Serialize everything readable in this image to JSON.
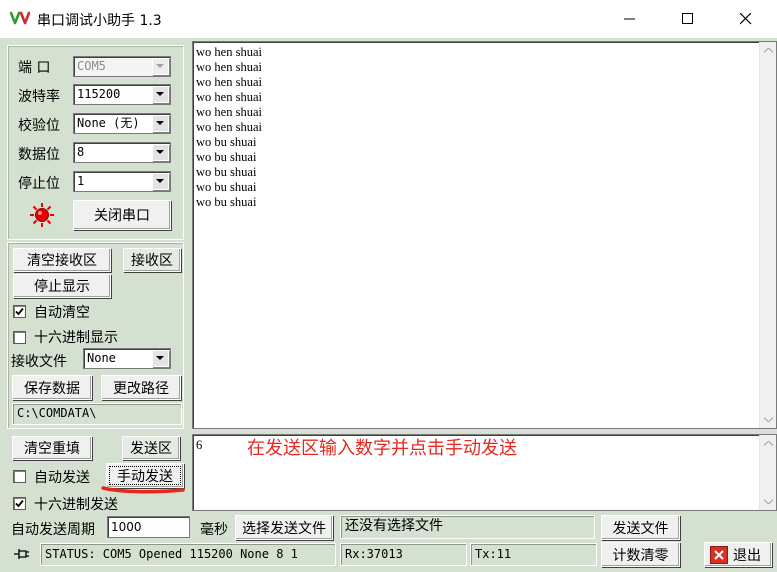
{
  "window": {
    "title": "串口调试小助手 1.3"
  },
  "settings": {
    "port_label": "端  口",
    "port_value": "COM5",
    "baud_label": "波特率",
    "baud_value": "115200",
    "parity_label": "校验位",
    "parity_value": "None (无)",
    "databits_label": "数据位",
    "databits_value": "8",
    "stopbits_label": "停止位",
    "stopbits_value": "1",
    "close_port_label": "关闭串口",
    "indicator_color": "#e60000"
  },
  "receive": {
    "clear_label": "清空接收区",
    "area_label": "接收区",
    "stop_display_label": "停止显示",
    "auto_clear_label": "自动清空",
    "auto_clear_checked": true,
    "hex_display_label": "十六进制显示",
    "hex_display_checked": false,
    "file_label": "接收文件",
    "file_value": "None",
    "save_label": "保存数据",
    "change_path_label": "更改路径",
    "path_value": "C:\\COMDATA\\",
    "lines": [
      "wo hen shuai",
      "wo hen shuai",
      "wo hen shuai",
      "wo hen shuai",
      "wo hen shuai",
      "wo hen shuai",
      "wo bu shuai",
      "wo bu shuai",
      "wo bu shuai",
      "wo bu shuai",
      "wo bu shuai"
    ]
  },
  "send": {
    "clear_label": "清空重填",
    "area_label": "发送区",
    "auto_send_label": "自动发送",
    "auto_send_checked": false,
    "manual_send_label": "手动发送",
    "hex_send_label": "十六进制发送",
    "hex_send_checked": true,
    "period_label": "自动发送周期",
    "period_value": "1000",
    "ms_label": "毫秒",
    "select_file_label": "选择发送文件",
    "file_status": "还没有选择文件",
    "send_file_label": "发送文件",
    "text": "6",
    "annotation": "在发送区输入数字并点击手动发送",
    "annotation_color": "#e8271e"
  },
  "statusbar": {
    "status_text": "STATUS: COM5 Opened 115200 None  8 1",
    "rx_text": "Rx:37013",
    "tx_text": "Tx:11",
    "reset_count_label": "计数清零",
    "exit_label": "退出"
  }
}
